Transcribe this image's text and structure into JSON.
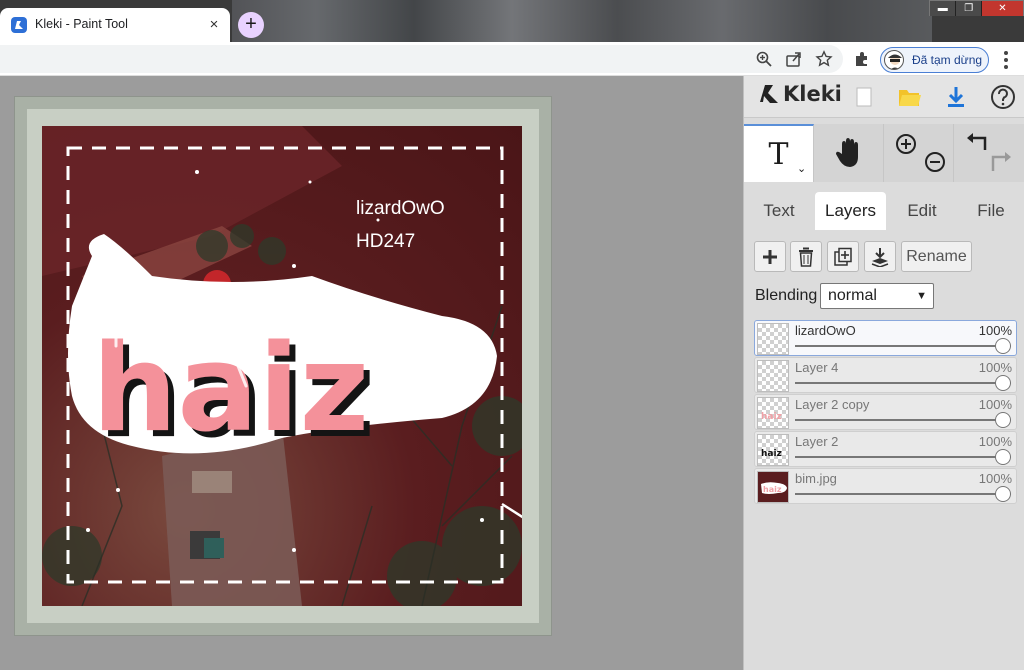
{
  "browser": {
    "tab_title": "Kleki - Paint Tool",
    "tab_close": "×",
    "new_tab": "+",
    "profile_label": "Đã tạm dừng"
  },
  "window": {
    "minimize": "▬",
    "maximize": "❐",
    "close": "✕"
  },
  "app": {
    "logo_text": "Kleki"
  },
  "canvas": {
    "overlay_text_1": "lizardOwO",
    "overlay_text_2": "HD247",
    "sticker_word": "haiz"
  },
  "panel": {
    "active_tool": "T",
    "tool_caret": "⌄",
    "tabs": [
      "Text",
      "Layers",
      "Edit",
      "File"
    ],
    "active_tab": "Layers",
    "rename_label": "Rename",
    "blending_label": "Blending",
    "blending_value": "normal",
    "layers": [
      {
        "name": "lizardOwO",
        "opacity": "100%",
        "opacity_fraction": 1.0,
        "selected": true
      },
      {
        "name": "Layer 4",
        "opacity": "100%",
        "opacity_fraction": 1.0,
        "selected": false
      },
      {
        "name": "Layer 2 copy",
        "opacity": "100%",
        "opacity_fraction": 1.0,
        "selected": false
      },
      {
        "name": "Layer 2",
        "opacity": "100%",
        "opacity_fraction": 1.0,
        "selected": false
      },
      {
        "name": "bim.jpg",
        "opacity": "100%",
        "opacity_fraction": 1.0,
        "selected": false
      }
    ]
  },
  "icons": {
    "zoom": "zoom-icon",
    "share": "share-icon",
    "star": "bookmark-star-icon",
    "extensions": "puzzle-icon",
    "menu": "three-dots-icon"
  }
}
